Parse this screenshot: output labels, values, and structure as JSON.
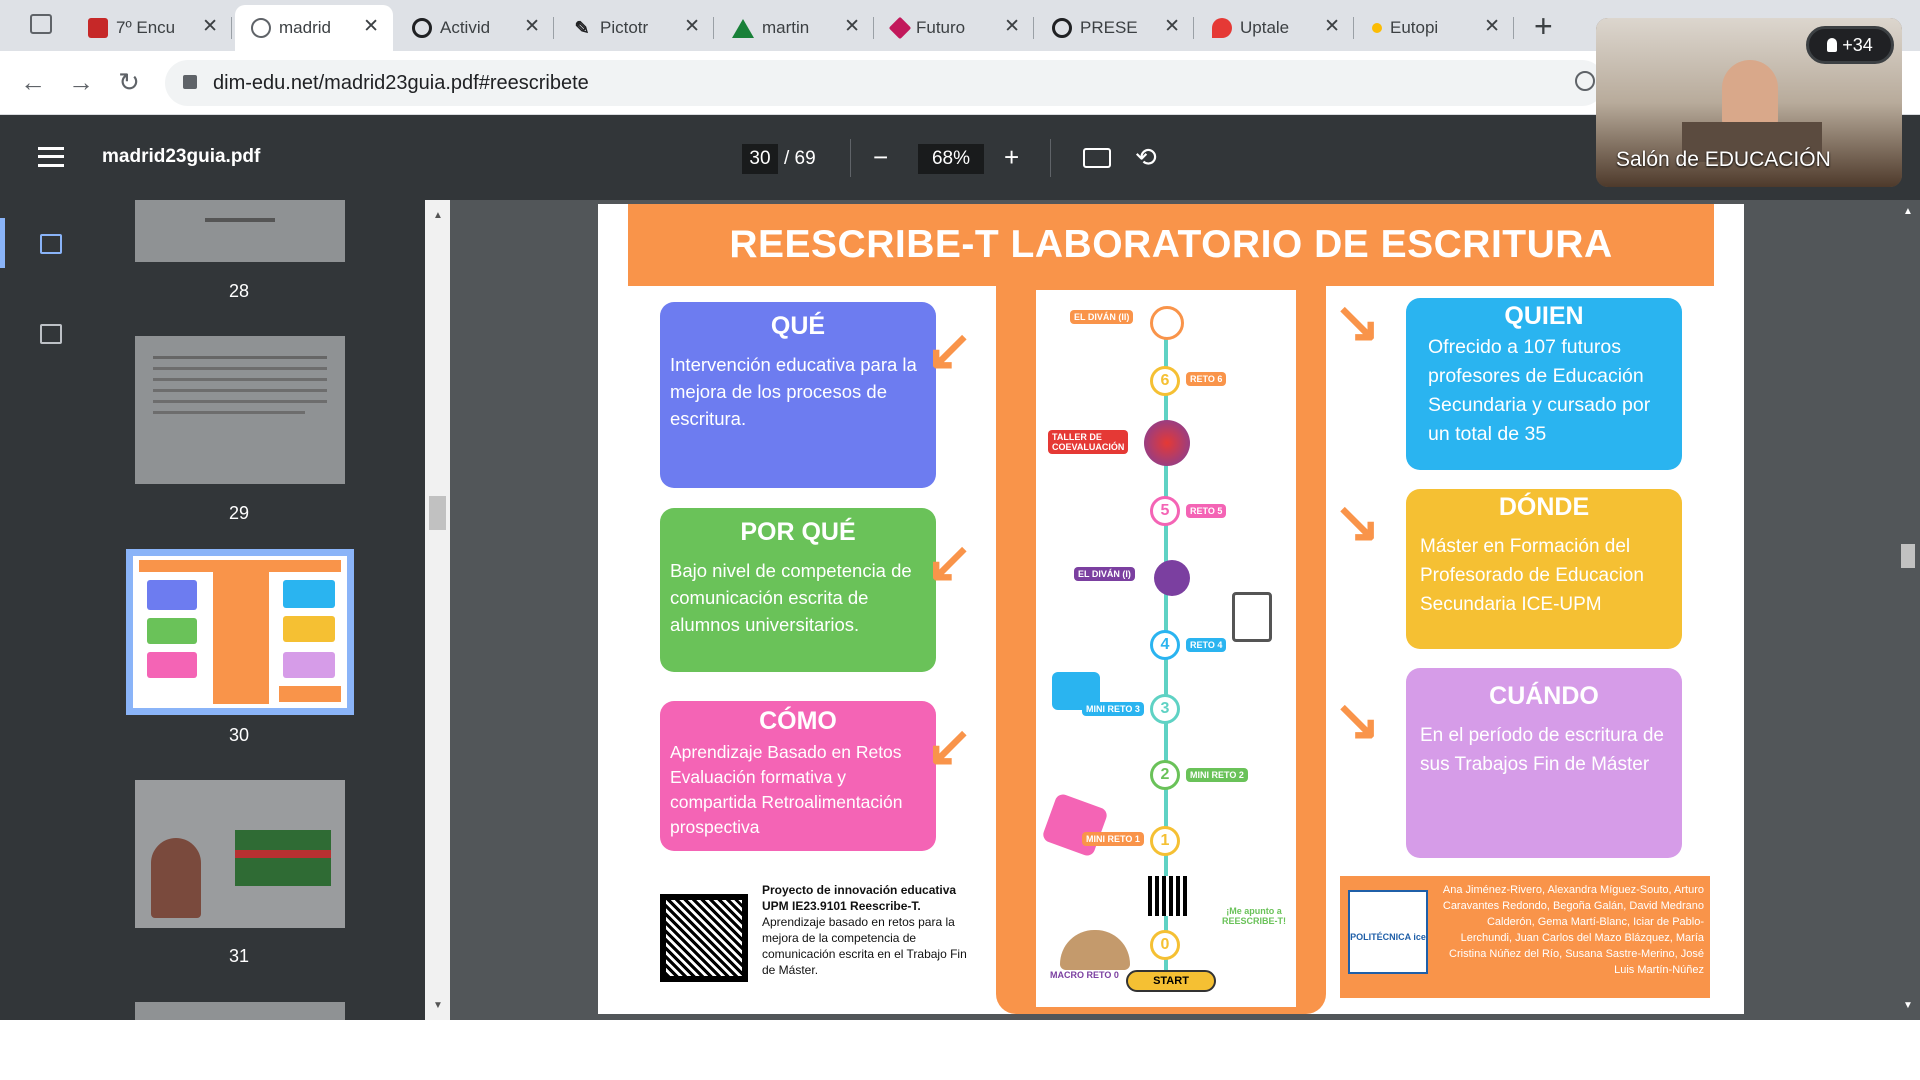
{
  "tabs": [
    {
      "title": "7º Encu",
      "color": "#c62828"
    },
    {
      "title": "madrid",
      "color": "#5f6368",
      "active": true
    },
    {
      "title": "Activid",
      "color": "#202124"
    },
    {
      "title": "Pictotr",
      "color": "#202124"
    },
    {
      "title": "martin",
      "color": "#188038"
    },
    {
      "title": "Futuro",
      "color": "#c2185b"
    },
    {
      "title": "PRESEN",
      "color": "#202124"
    },
    {
      "title": "Uptale",
      "color": "#e53935"
    },
    {
      "title": "Eutopi",
      "color": "#fbbc04"
    }
  ],
  "browser": {
    "url": "dim-edu.net/madrid23guia.pdf#reescribete",
    "new_tab": "+",
    "close": "✕"
  },
  "pdf": {
    "title": "madrid23guia.pdf",
    "page_current": "30",
    "page_total": "/ 69",
    "zoom": "68%"
  },
  "thumbnails": [
    {
      "num": "28"
    },
    {
      "num": "29"
    },
    {
      "num": "30",
      "selected": true
    },
    {
      "num": "31"
    }
  ],
  "poster": {
    "title": "REESCRIBE-T LABORATORIO DE ESCRITURA",
    "que": {
      "heading": "QUÉ",
      "text": "Intervención educativa para la mejora de los procesos de escritura."
    },
    "porque": {
      "heading": "POR QUÉ",
      "text": "Bajo nivel de competencia de comunicación escrita de alumnos universitarios."
    },
    "como": {
      "heading": "CÓMO",
      "text": "Aprendizaje Basado en Retos Evaluación formativa y compartida Retroalimentación prospectiva"
    },
    "quien": {
      "heading": "QUIEN",
      "text": "Ofrecido a 107 futuros profesores de Educación Secundaria y cursado por un total de 35"
    },
    "donde": {
      "heading": "DÓNDE",
      "text": "Máster en Formación del Profesorado de Educacion Secundaria ICE-UPM"
    },
    "cuando": {
      "heading": "CUÁNDO",
      "text": "En el período de escritura de sus Trabajos Fin de Máster"
    },
    "project_title": "Proyecto de innovación educativa UPM IE23.9101 Reescribe-T.",
    "project_text": "Aprendizaje basado en retos para la mejora de la competencia de comunicación escrita en el Trabajo Fin de Máster.",
    "path_steps": [
      "EL DIVÁN (II)",
      "RETO 6",
      "TALLER DE COEVALUACIÓN",
      "RETO 5",
      "EL DIVÁN (I)",
      "RETO 4",
      "MINI RETO 3",
      "MINI RETO 2",
      "MINI RETO 1",
      "MACRO RETO 0",
      "START",
      "¡Me apunto a REESCRIBE-T!"
    ],
    "credits": "Ana Jiménez-Rivero, Alexandra Míguez-Souto, Arturo Caravantes Redondo, Begoña Galán, David Medrano Calderón, Gema Martí-Blanc, Iciar de Pablo-Lerchundi, Juan Carlos del Mazo Blázquez, María Cristina Núñez del Río, Susana Sastre-Merino, José Luis Martín-Núñez",
    "logo": "POLITÉCNICA ice"
  },
  "webcam": {
    "label": "Salón de EDUCACIÓN",
    "participants": "+34"
  }
}
